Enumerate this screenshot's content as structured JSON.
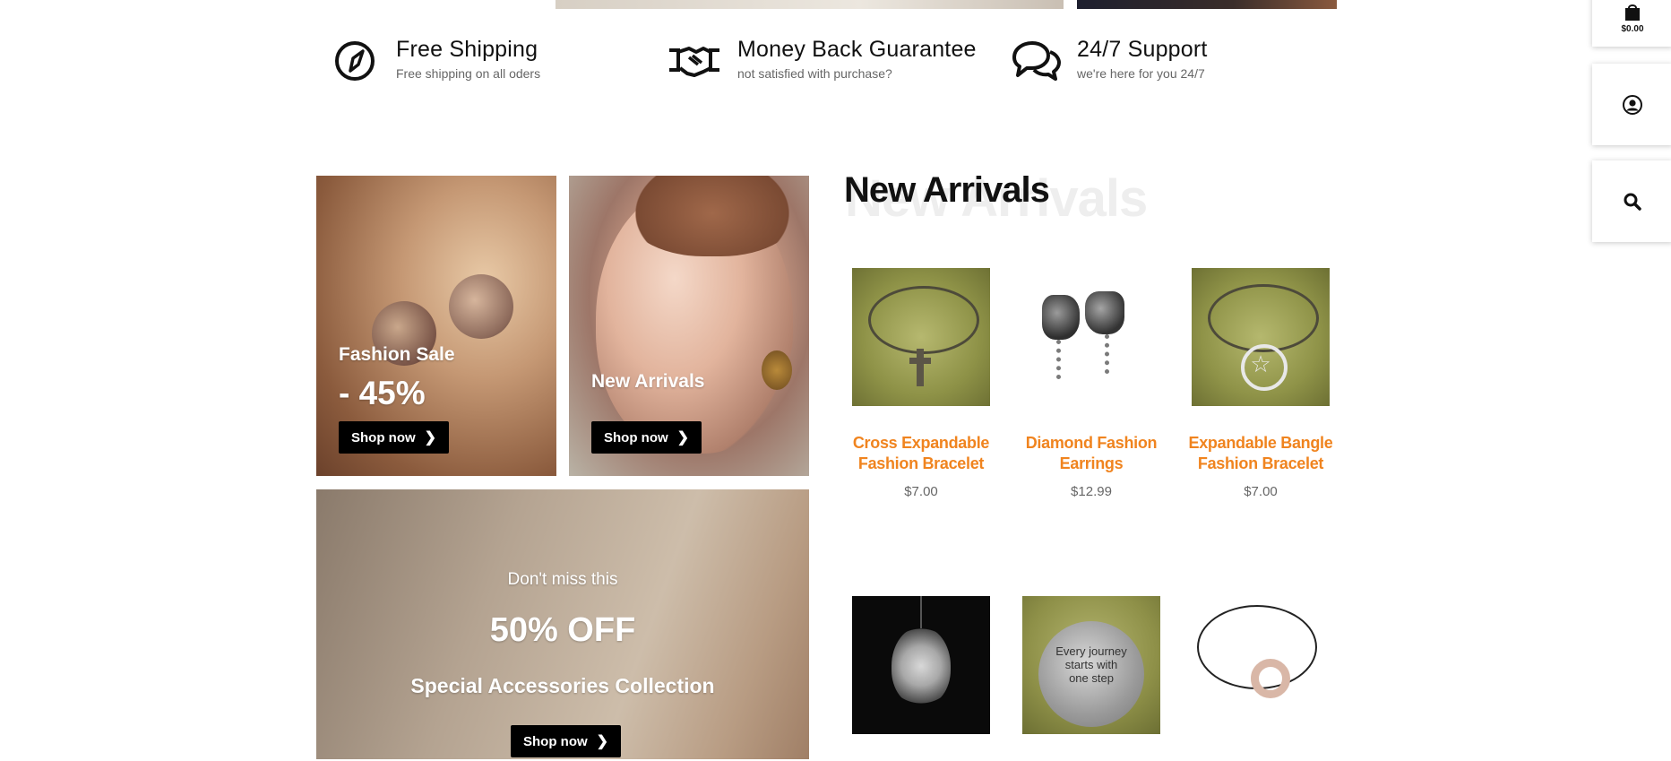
{
  "cart": {
    "total": "$0.00"
  },
  "features": [
    {
      "title": "Free Shipping",
      "subtitle": "Free shipping on all oders",
      "icon": "compass-icon"
    },
    {
      "title": "Money Back Guarantee",
      "subtitle": "not satisfied with purchase?",
      "icon": "handshake-icon"
    },
    {
      "title": "24/7 Support",
      "subtitle": "we're here for you 24/7",
      "icon": "chat-bubbles-icon"
    }
  ],
  "promos": {
    "fashion_sale": {
      "title": "Fashion Sale",
      "discount": "- 45%",
      "button": "Shop now"
    },
    "new_arrivals": {
      "title": "New Arrivals",
      "button": "Shop now"
    },
    "special": {
      "kicker": "Don't miss this",
      "headline": "50% OFF",
      "subtitle": "Special Accessories Collection",
      "button": "Shop now"
    }
  },
  "new_arrivals": {
    "title": "New Arrivals",
    "ghost": "New Arrivals",
    "products": [
      {
        "name": "Cross Expandable Fashion Bracelet",
        "price": "$7.00"
      },
      {
        "name": "Diamond Fashion Earrings",
        "price": "$12.99"
      },
      {
        "name": "Expandable Bangle Fashion Bracelet",
        "price": "$7.00"
      },
      {
        "name": "",
        "price": ""
      },
      {
        "name": "",
        "price": "",
        "image_text": "Every journey starts with one step"
      },
      {
        "name": "",
        "price": ""
      }
    ]
  },
  "colors": {
    "accent": "#f0841f",
    "button": "#000000"
  }
}
